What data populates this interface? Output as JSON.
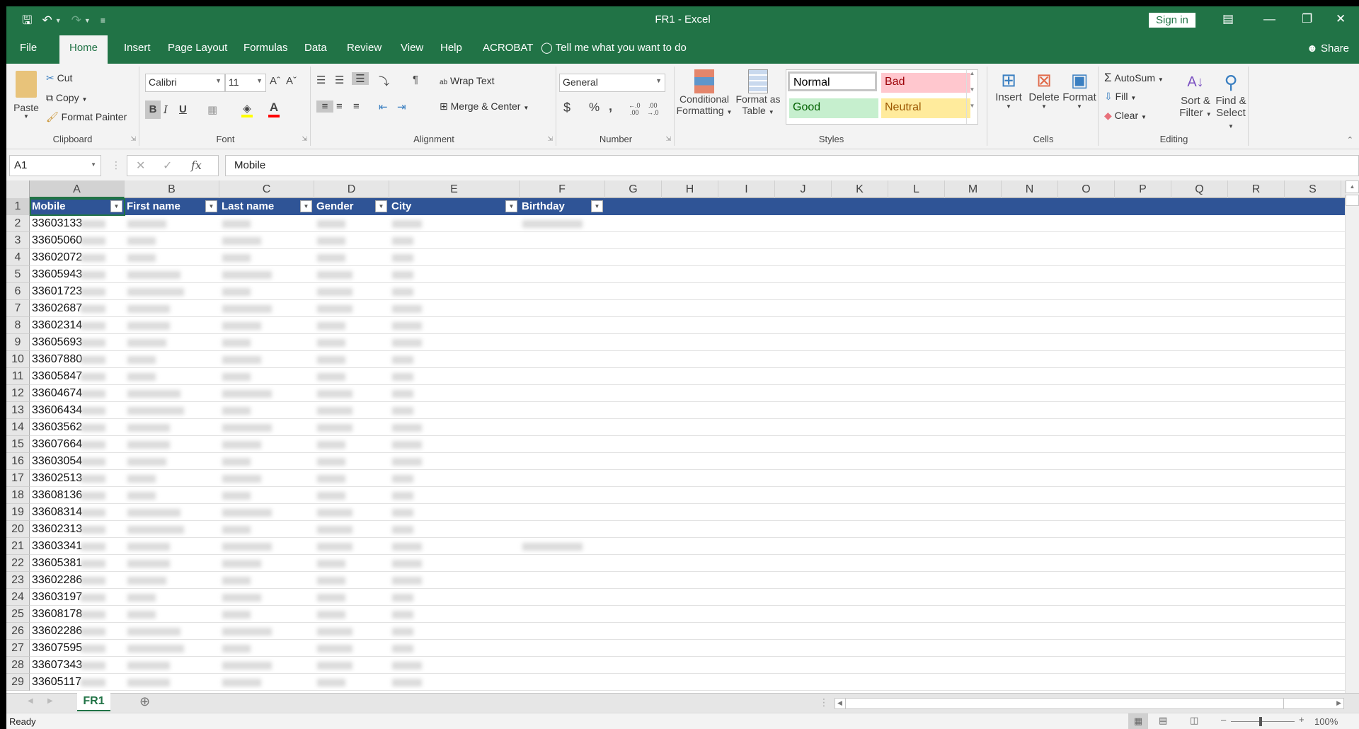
{
  "window": {
    "title": "FR1  -  Excel",
    "sign_in": "Sign in"
  },
  "qat": {
    "save": "save-icon",
    "undo": "undo-icon",
    "redo": "redo-icon"
  },
  "tabs": [
    "File",
    "Home",
    "Insert",
    "Page Layout",
    "Formulas",
    "Data",
    "Review",
    "View",
    "Help",
    "ACROBAT"
  ],
  "active_tab": "Home",
  "tell_me": "Tell me what you want to do",
  "share": "Share",
  "ribbon": {
    "clipboard": {
      "label": "Clipboard",
      "paste": "Paste",
      "cut": "Cut",
      "copy": "Copy",
      "format_painter": "Format Painter"
    },
    "font": {
      "label": "Font",
      "font_name": "Calibri",
      "font_size": "11",
      "bold": "B",
      "italic": "I",
      "underline": "U",
      "fill_color": "#ffff00",
      "font_color": "#ff0000"
    },
    "alignment": {
      "label": "Alignment",
      "wrap_text": "Wrap Text",
      "merge_center": "Merge & Center"
    },
    "number": {
      "label": "Number",
      "format": "General",
      "currency": "$",
      "percent": "%",
      "comma": ","
    },
    "styles": {
      "label": "Styles",
      "conditional": "Conditional",
      "conditional2": "Formatting",
      "format_as": "Format as",
      "format_as2": "Table",
      "normal": "Normal",
      "bad": "Bad",
      "good": "Good",
      "neutral": "Neutral"
    },
    "cells": {
      "label": "Cells",
      "insert": "Insert",
      "delete": "Delete",
      "format": "Format"
    },
    "editing": {
      "label": "Editing",
      "autosum": "AutoSum",
      "fill": "Fill",
      "clear": "Clear",
      "sort": "Sort &",
      "sort2": "Filter",
      "find": "Find &",
      "find2": "Select"
    }
  },
  "formula_bar": {
    "name_box": "A1",
    "formula": "Mobile"
  },
  "columns": [
    "A",
    "B",
    "C",
    "D",
    "E",
    "F",
    "G",
    "H",
    "I",
    "J",
    "K",
    "L",
    "M",
    "N",
    "O",
    "P",
    "Q",
    "R",
    "S"
  ],
  "table_headers": [
    "Mobile",
    "First name",
    "Last name",
    "Gender",
    "City",
    "Birthday"
  ],
  "header_color": "#2f5496",
  "rows": [
    "33603133",
    "33605060",
    "33602072",
    "33605943",
    "33601723",
    "33602687",
    "33602314",
    "33605693",
    "33607880",
    "33605847",
    "33604674",
    "33606434",
    "33603562",
    "33607664",
    "33603054",
    "33602513",
    "33608136",
    "33608314",
    "33602313",
    "33603341",
    "33605381",
    "33602286",
    "33603197",
    "33608178",
    "33602286",
    "33607595",
    "33607343",
    "33605117"
  ],
  "sheet_tab": "FR1",
  "status": {
    "text": "Ready",
    "zoom": "100%"
  }
}
